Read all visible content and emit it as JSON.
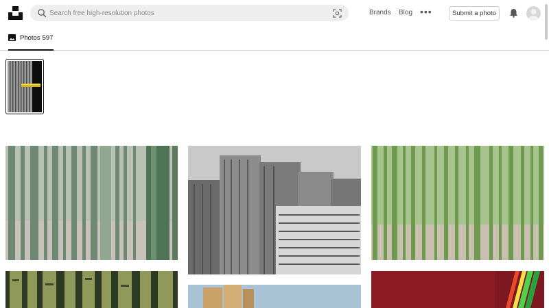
{
  "header": {
    "logo_name": "unsplash-logo",
    "search": {
      "placeholder": "Search free high-resolution photos"
    },
    "nav": [
      "Brands",
      "Blog"
    ],
    "more_label": "•••",
    "submit_label": "Submit a photo"
  },
  "tabs": [
    {
      "label": "Photos",
      "count": "597",
      "active": true
    }
  ],
  "photos": [
    {
      "subject": "bamboo forest"
    },
    {
      "subject": "grey high-rise apartment buildings"
    },
    {
      "subject": "green bamboo forest"
    },
    {
      "subject": "carved bamboo stalks"
    },
    {
      "subject": "tan high-rise buildings against blue sky"
    },
    {
      "subject": "red abstract with light streaks"
    }
  ],
  "colors": {
    "accent": "#111111",
    "search_bg": "#eeeeee",
    "border": "#d1d1d1"
  }
}
